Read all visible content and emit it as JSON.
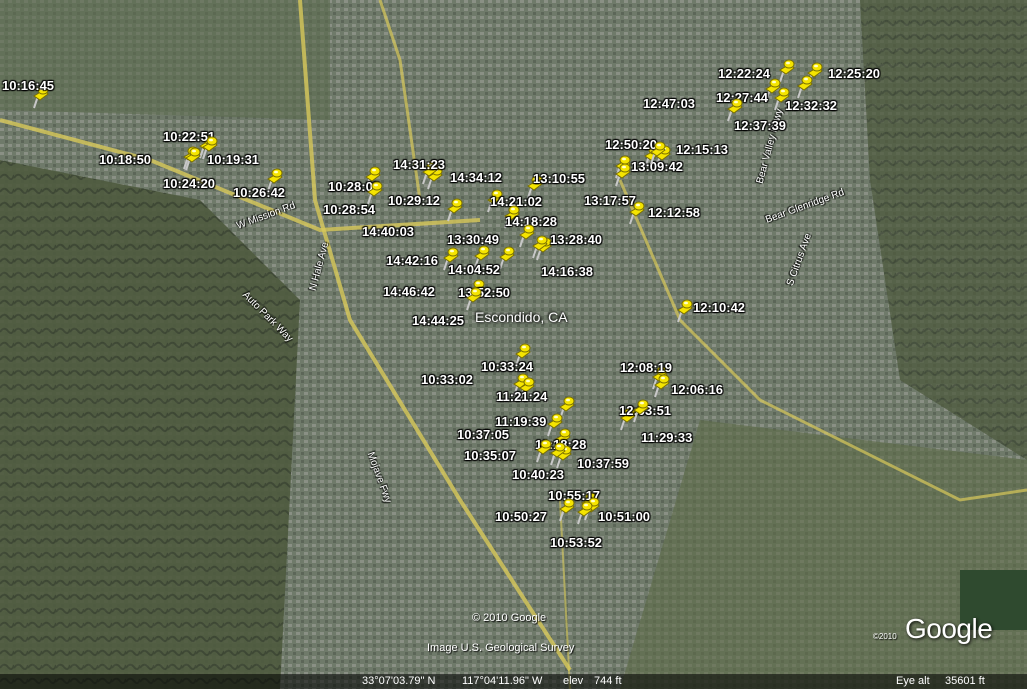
{
  "map": {
    "city_label": "Escondido, CA",
    "copyright_center": "© 2010 Google",
    "imagery_credit": "Image U.S. Geological Survey",
    "logo": "Google",
    "logo_copyright": "©2010"
  },
  "roads": [
    {
      "name": "W Mission Rd"
    },
    {
      "name": "Auto Park Way"
    },
    {
      "name": "N Hale Ave"
    },
    {
      "name": "Mojave Fwy"
    },
    {
      "name": "Bear Valley Pkwy"
    },
    {
      "name": "Bear Glenridge Rd"
    },
    {
      "name": "S Citrus Ave"
    }
  ],
  "pins": [
    {
      "time": "10:16:45",
      "color": "#f5e400"
    },
    {
      "time": "10:22:51",
      "color": "#f5e400"
    },
    {
      "time": "10:18:50",
      "color": "#f5e400"
    },
    {
      "time": "10:19:31",
      "color": "#f5e400"
    },
    {
      "time": "10:24:20",
      "color": "#f5e400"
    },
    {
      "time": "10:26:42",
      "color": "#f5e400"
    },
    {
      "time": "10:28:03",
      "color": "#f5e400"
    },
    {
      "time": "10:28:54",
      "color": "#f5e400"
    },
    {
      "time": "10:29:12",
      "color": "#f5e400"
    },
    {
      "time": "14:31:23",
      "color": "#f5e400"
    },
    {
      "time": "14:34:12",
      "color": "#f5e400"
    },
    {
      "time": "14:21:02",
      "color": "#f5e400"
    },
    {
      "time": "14:18:28",
      "color": "#f5e400"
    },
    {
      "time": "14:40:03",
      "color": "#f5e400"
    },
    {
      "time": "13:30:49",
      "color": "#f5e400"
    },
    {
      "time": "13:28:40",
      "color": "#f5e400"
    },
    {
      "time": "14:42:16",
      "color": "#f5e400"
    },
    {
      "time": "14:04:52",
      "color": "#f5e400"
    },
    {
      "time": "14:16:38",
      "color": "#f5e400"
    },
    {
      "time": "14:46:42",
      "color": "#f5e400"
    },
    {
      "time": "13:52:50",
      "color": "#f5e400"
    },
    {
      "time": "14:44:25",
      "color": "#f5e400"
    },
    {
      "time": "13:10:55",
      "color": "#f5e400"
    },
    {
      "time": "13:17:57",
      "color": "#f5e400"
    },
    {
      "time": "12:50:20",
      "color": "#f5e400"
    },
    {
      "time": "13:09:42",
      "color": "#f5e400"
    },
    {
      "time": "12:15:13",
      "color": "#f5e400"
    },
    {
      "time": "12:12:58",
      "color": "#f5e400"
    },
    {
      "time": "12:22:24",
      "color": "#f5e400"
    },
    {
      "time": "12:25:20",
      "color": "#f5e400"
    },
    {
      "time": "12:27:44",
      "color": "#f5e400"
    },
    {
      "time": "12:47:03",
      "color": "#f5e400"
    },
    {
      "time": "12:32:32",
      "color": "#f5e400"
    },
    {
      "time": "12:37:39",
      "color": "#f5e400"
    },
    {
      "time": "12:10:42",
      "color": "#f5e400"
    },
    {
      "time": "12:08:19",
      "color": "#f5e400"
    },
    {
      "time": "12:06:16",
      "color": "#f5e400"
    },
    {
      "time": "12:03:51",
      "color": "#f5e400"
    },
    {
      "time": "11:29:33",
      "color": "#f5e400"
    },
    {
      "time": "10:33:24",
      "color": "#f5e400"
    },
    {
      "time": "10:33:02",
      "color": "#f5e400"
    },
    {
      "time": "11:21:24",
      "color": "#f5e400"
    },
    {
      "time": "11:19:39",
      "color": "#f5e400"
    },
    {
      "time": "10:37:05",
      "color": "#f5e400"
    },
    {
      "time": "11:18:28",
      "color": "#f5e400"
    },
    {
      "time": "10:35:07",
      "color": "#f5e400"
    },
    {
      "time": "10:37:59",
      "color": "#f5e400"
    },
    {
      "time": "10:40:23",
      "color": "#f5e400"
    },
    {
      "time": "10:55:17",
      "color": "#f5e400"
    },
    {
      "time": "10:50:27",
      "color": "#f5e400"
    },
    {
      "time": "10:51:00",
      "color": "#f5e400"
    },
    {
      "time": "10:53:52",
      "color": "#f5e400"
    }
  ],
  "status_bar": {
    "lat": "33°07'03.79\" N",
    "lon": "117°04'11.96\" W",
    "elev_label": "elev",
    "elev_value": "744 ft",
    "eye_alt_label": "Eye alt",
    "eye_alt_value": "35601 ft"
  }
}
